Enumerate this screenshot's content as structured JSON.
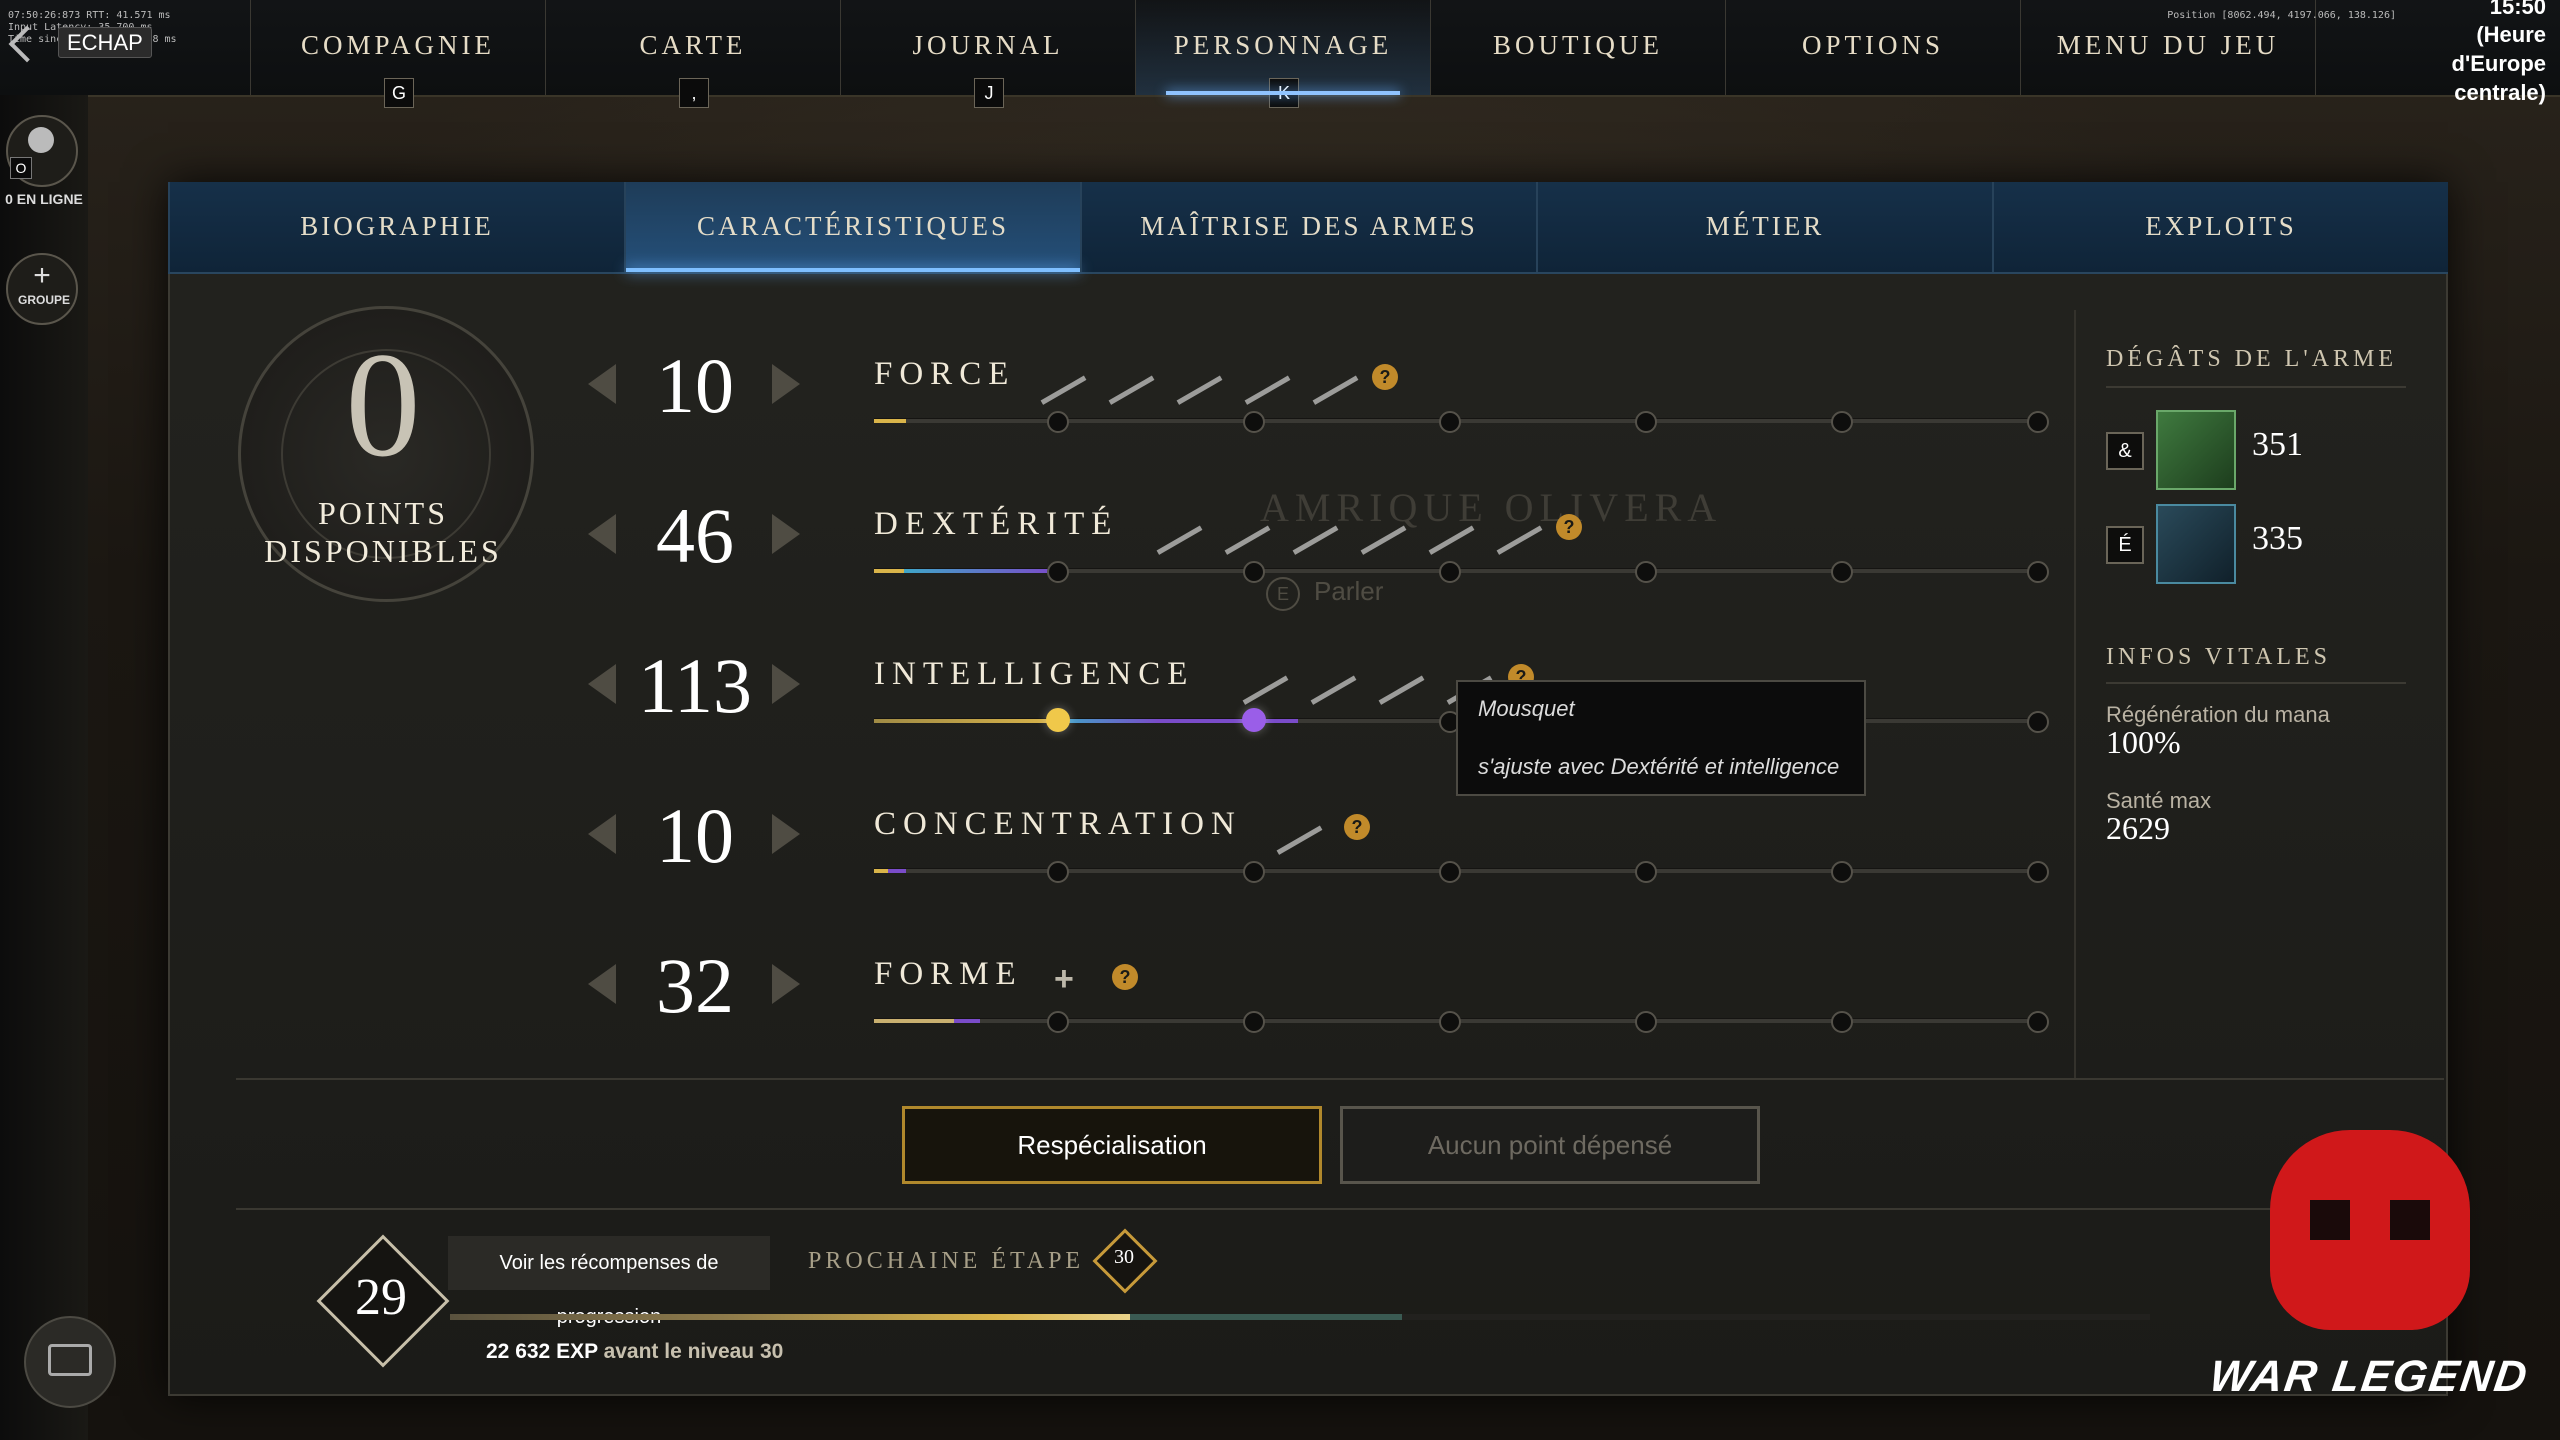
{
  "topbar": {
    "escape_label": "ECHAP",
    "debug": [
      "07:50:26:873  RTT: 41.571 ms",
      "Input Latency: 35.700 ms",
      "Time since last frame:  28 ms"
    ],
    "nav": [
      {
        "label": "COMPAGNIE",
        "key": "G"
      },
      {
        "label": "CARTE",
        "key": ","
      },
      {
        "label": "JOURNAL",
        "key": "J"
      },
      {
        "label": "PERSONNAGE",
        "key": "K",
        "active": true
      },
      {
        "label": "BOUTIQUE",
        "key": ""
      },
      {
        "label": "OPTIONS",
        "key": ""
      },
      {
        "label": "MENU DU JEU",
        "key": ""
      }
    ],
    "time": "15:50",
    "timezone": [
      "(Heure",
      "d'Europe",
      "centrale)"
    ],
    "position": "Position [8062.494, 4197.066, 138.126]"
  },
  "rail": {
    "online_key": "O",
    "online_label": "0 EN LIGNE",
    "group_label": "GROUPE"
  },
  "tabs": [
    "BIOGRAPHIE",
    "CARACTÉRISTIQUES",
    "MAÎTRISE DES ARMES",
    "MÉTIER",
    "EXPLOITS"
  ],
  "points": {
    "value": "0",
    "label_line1": "POINTS",
    "label_line2": "DISPONIBLES"
  },
  "attributes": [
    {
      "name": "FORCE",
      "value": "10",
      "weapons": 5,
      "help": "?"
    },
    {
      "name": "DEXTÉRITÉ",
      "value": "46",
      "weapons": 6,
      "help": "?"
    },
    {
      "name": "INTELLIGENCE",
      "value": "113",
      "weapons": 4,
      "help": "?"
    },
    {
      "name": "CONCENTRATION",
      "value": "10",
      "weapons": 1,
      "help": "?"
    },
    {
      "name": "FORME",
      "value": "32",
      "weapons": 0,
      "help": "?",
      "plus": "+"
    }
  ],
  "tooltip": {
    "title": "Mousquet",
    "text": "s'ajuste avec Dextérité et intelligence"
  },
  "background_npc": {
    "name": "AMRIQUE OLIVERA",
    "prompt": "Parler",
    "prompt_key": "E"
  },
  "weapon_damage": {
    "title": "DÉGÂTS DE L'ARME",
    "weapons": [
      {
        "key": "&",
        "damage": "351"
      },
      {
        "key": "É",
        "damage": "335"
      }
    ]
  },
  "vitals": {
    "title": "INFOS VITALES",
    "items": [
      {
        "label": "Régénération du mana",
        "value": "100%"
      },
      {
        "label": "Santé max",
        "value": "2629"
      }
    ]
  },
  "buttons": {
    "respec": "Respécialisation",
    "no_points": "Aucun point dépensé"
  },
  "progress": {
    "level": "29",
    "rewards_button": "Voir les récompenses de progression",
    "next_label": "PROCHAINE ÉTAPE",
    "next_level": "30",
    "xp_remaining": "22 632 EXP",
    "xp_suffix": "avant le niveau 30",
    "xp_fraction": 0.4
  },
  "watermark": "WAR LEGEND",
  "colors": {
    "accent_blue": "#7fbfff",
    "tab_bg": "#163049",
    "gold": "#c18a2a",
    "dex_purple": "#7a4cc9",
    "int_gold": "#d9b44a"
  }
}
